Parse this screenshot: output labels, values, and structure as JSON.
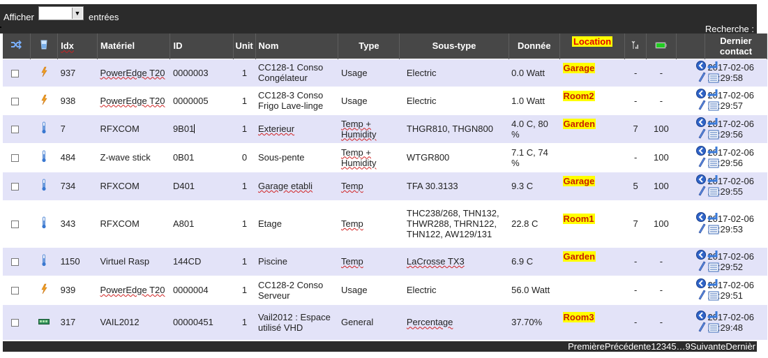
{
  "length_menu": {
    "prefix": "Afficher",
    "suffix": "entrées",
    "selected": ""
  },
  "search": {
    "label": "Recherche :"
  },
  "columns": {
    "idx": "Idx",
    "materiel": "Matériel",
    "id": "ID",
    "unit": "Unit",
    "nom": "Nom",
    "type": "Type",
    "sous_type": "Sous-type",
    "donnee": "Donnée",
    "location": "Location",
    "dernier_contact": "Dernier contact"
  },
  "rows": [
    {
      "idx": "937",
      "materiel": "PowerEdge T20",
      "id": "0000003",
      "unit": "1",
      "nom": "CC128-1 Conso Congélateur",
      "type": "Usage",
      "sous_type": "Electric",
      "donnee": "0.0 Watt",
      "location": "Garage",
      "signal": "-",
      "battery": "-",
      "last": "2017-02-06 23:29:58",
      "icon": "power-icon"
    },
    {
      "idx": "938",
      "materiel": "PowerEdge T20",
      "id": "0000005",
      "unit": "1",
      "nom": "CC128-3 Conso Frigo Lave-linge",
      "type": "Usage",
      "sous_type": "Electric",
      "donnee": "1.0 Watt",
      "location": "Room2",
      "signal": "-",
      "battery": "-",
      "last": "2017-02-06 23:29:57",
      "icon": "power-icon"
    },
    {
      "idx": "7",
      "materiel": "RFXCOM",
      "id": "9B01",
      "unit": "1",
      "nom": "Exterieur",
      "type": "Temp + Humidity",
      "sous_type": "THGR810, THGN800",
      "donnee": "4.0 C, 80 %",
      "location": "Garden",
      "signal": "7",
      "battery": "100",
      "last": "2017-02-06 23:29:56",
      "icon": "thermometer-icon"
    },
    {
      "idx": "484",
      "materiel": "Z-wave stick",
      "id": "0B01",
      "unit": "0",
      "nom": "Sous-pente",
      "type": "Temp + Humidity",
      "sous_type": "WTGR800",
      "donnee": "7.1 C, 74 %",
      "location": "",
      "signal": "-",
      "battery": "100",
      "last": "2017-02-06 23:29:56",
      "icon": "thermometer-icon"
    },
    {
      "idx": "734",
      "materiel": "RFXCOM",
      "id": "D401",
      "unit": "1",
      "nom": "Garage etabli",
      "type": "Temp",
      "sous_type": "TFA 30.3133",
      "donnee": "9.3 C",
      "location": "Garage",
      "signal": "5",
      "battery": "100",
      "last": "2017-02-06 23:29:55",
      "icon": "thermometer-icon"
    },
    {
      "idx": "343",
      "materiel": "RFXCOM",
      "id": "A801",
      "unit": "1",
      "nom": "Etage",
      "type": "Temp",
      "sous_type": "THC238/268, THN132, THWR288, THRN122, THN122, AW129/131",
      "donnee": "22.8 C",
      "location": "Room1",
      "signal": "7",
      "battery": "100",
      "last": "2017-02-06 23:29:53",
      "icon": "thermometer-icon"
    },
    {
      "idx": "1150",
      "materiel": "Virtuel Rasp",
      "id": "144CD",
      "unit": "1",
      "nom": "Piscine",
      "type": "Temp",
      "sous_type": "LaCrosse TX3",
      "donnee": "6.9 C",
      "location": "Garden",
      "signal": "-",
      "battery": "-",
      "last": "2017-02-06 23:29:52",
      "icon": "thermometer-icon"
    },
    {
      "idx": "939",
      "materiel": "PowerEdge T20",
      "id": "0000004",
      "unit": "1",
      "nom": "CC128-2 Conso Serveur",
      "type": "Usage",
      "sous_type": "Electric",
      "donnee": "56.0 Watt",
      "location": "",
      "signal": "-",
      "battery": "-",
      "last": "2017-02-06 23:29:51",
      "icon": "power-icon"
    },
    {
      "idx": "317",
      "materiel": "VAIL2012",
      "id": "00000451",
      "unit": "1",
      "nom": "Vail2012 : Espace utilisé VHD",
      "type": "General",
      "sous_type": "Percentage",
      "donnee": "37.70%",
      "location": "Room3",
      "signal": "-",
      "battery": "-",
      "last": "2017-02-06 23:29:48",
      "icon": "percentage-icon"
    }
  ],
  "pagination": {
    "first": "Première",
    "previous": "Précédente",
    "pages": [
      "1",
      "2",
      "3",
      "4",
      "5"
    ],
    "ellipsis": "…",
    "last_page": "9",
    "next": "Suivante",
    "last": "Dernièr"
  }
}
